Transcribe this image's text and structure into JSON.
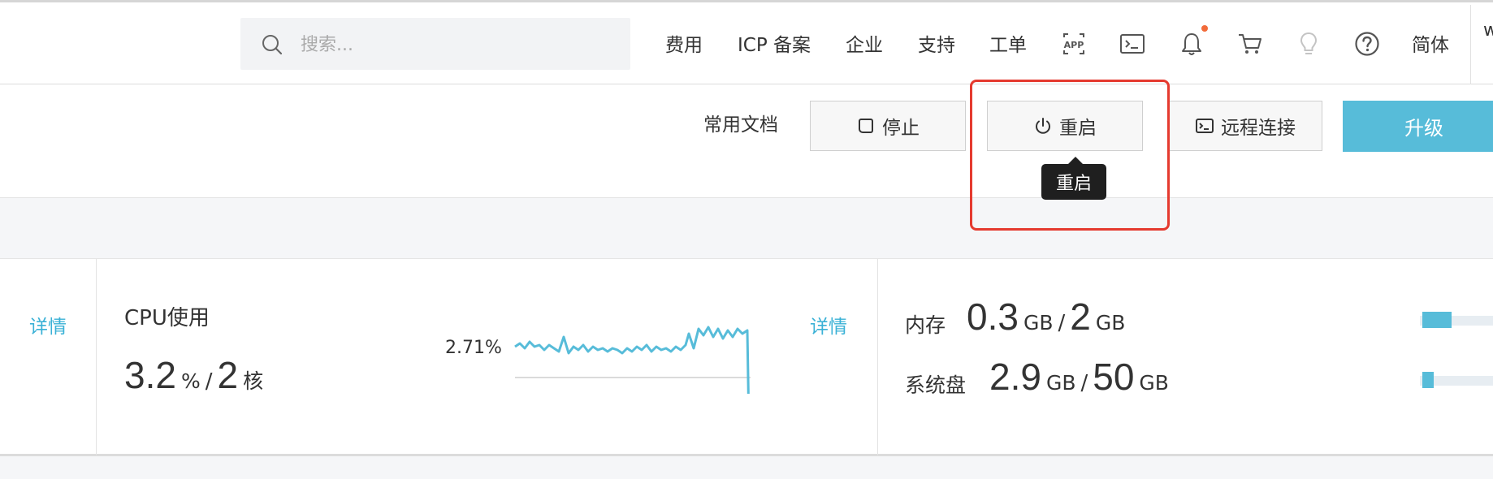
{
  "header": {
    "search_placeholder": "搜索...",
    "nav": [
      "费用",
      "ICP 备案",
      "企业",
      "支持",
      "工单"
    ],
    "icons": [
      "app-icon",
      "terminal-icon",
      "bell-icon",
      "cart-icon",
      "lightbulb-icon",
      "help-icon"
    ],
    "language": "简体",
    "truncated": "w"
  },
  "toolbar": {
    "docs_label": "常用文档",
    "stop_label": "停止",
    "restart_label": "重启",
    "remote_label": "远程连接",
    "upgrade_label": "升级",
    "tooltip": "重启"
  },
  "metrics": {
    "detail_label": "详情",
    "cpu": {
      "title": "CPU使用",
      "value": "3.2",
      "value_unit": "%",
      "separator": "/",
      "total": "2",
      "total_unit": "核",
      "chart_label": "2.71%"
    },
    "memory": {
      "label": "内存",
      "used": "0.3",
      "used_unit": "GB",
      "separator": "/",
      "total": "2",
      "total_unit": "GB",
      "fraction": 0.15
    },
    "disk": {
      "label": "系统盘",
      "used": "2.9",
      "used_unit": "GB",
      "separator": "/",
      "total": "50",
      "total_unit": "GB",
      "fraction": 0.058
    }
  },
  "colors": {
    "accent": "#57bcd9",
    "link": "#3ab1d6",
    "highlight": "#e53a2f",
    "notification_dot": "#f26b3a"
  }
}
